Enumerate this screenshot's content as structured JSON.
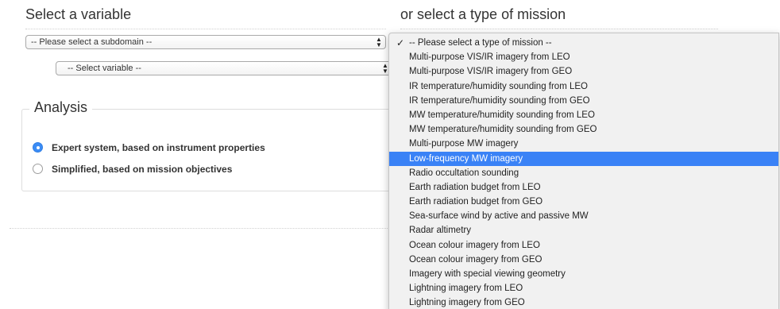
{
  "left": {
    "heading": "Select a variable",
    "subdomain_select": {
      "value": "-- Please select a subdomain --"
    },
    "variable_select": {
      "value": "-- Select variable --"
    }
  },
  "right": {
    "heading": "or select a type of mission"
  },
  "analysis": {
    "legend": "Analysis",
    "options": [
      {
        "label": "Expert system, based on instrument properties",
        "checked": true
      },
      {
        "label": "Simplified, based on mission objectives",
        "checked": false
      }
    ]
  },
  "mission_dropdown": {
    "selected_index": 0,
    "highlighted_index": 8,
    "check_glyph": "✓",
    "items": [
      "-- Please select a type of mission --",
      "Multi-purpose VIS/IR imagery from LEO",
      "Multi-purpose VIS/IR imagery from GEO",
      "IR temperature/humidity sounding from LEO",
      "IR temperature/humidity sounding from GEO",
      "MW temperature/humidity sounding from LEO",
      "MW temperature/humidity sounding from GEO",
      "Multi-purpose MW imagery",
      "Low-frequency MW imagery",
      "Radio occultation sounding",
      "Earth radiation budget from LEO",
      "Earth radiation budget from GEO",
      "Sea-surface wind by active and passive MW",
      "Radar altimetry",
      "Ocean colour imagery from LEO",
      "Ocean colour imagery from GEO",
      "Imagery with special viewing geometry",
      "Lightning imagery from LEO",
      "Lightning imagery from GEO"
    ]
  },
  "colors": {
    "highlight": "#3a82f6",
    "radio_checked": "#3b8cf5",
    "menu_background": "#f1f1f1"
  },
  "icons": {
    "select_stepper": "up-down-stepper-icon",
    "selected_check": "checkmark-icon"
  }
}
